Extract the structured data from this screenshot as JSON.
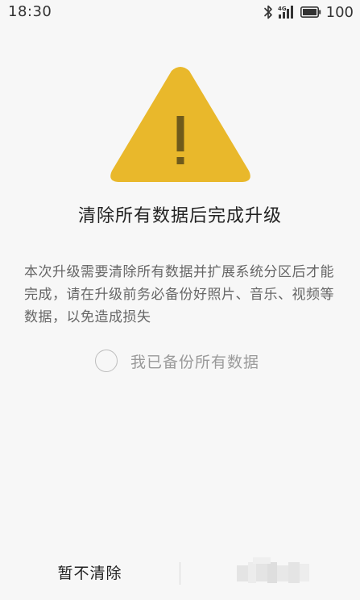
{
  "status_bar": {
    "time": "18:30",
    "network": "4G",
    "battery": "100"
  },
  "icons": {
    "warning": "warning-triangle-icon",
    "bluetooth": "bluetooth-icon",
    "signal": "signal-icon",
    "battery": "battery-icon"
  },
  "colors": {
    "warning": "#E9B82B",
    "exclamation": "#6F5A1B",
    "background": "#F7F7F7"
  },
  "dialog": {
    "title": "清除所有数据后完成升级",
    "description": "本次升级需要清除所有数据并扩展系统分区后才能完成，请在升级前务必备份好照片、音乐、视频等数据，以免造成损失",
    "confirm_label": "我已备份所有数据",
    "confirm_checked": false
  },
  "actions": {
    "skip_label": "暂不清除"
  }
}
